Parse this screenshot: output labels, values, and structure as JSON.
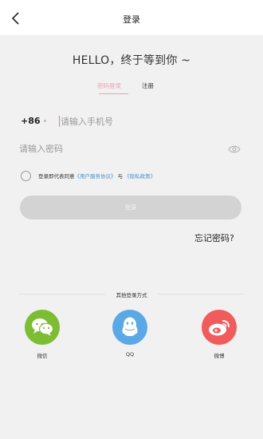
{
  "header": {
    "title": "登录"
  },
  "greeting": "HELLO，终于等到你 ~",
  "tabs": {
    "login": "密码登录",
    "register": "注册"
  },
  "form": {
    "country_code": "+86",
    "phone_placeholder": "请输入手机号",
    "password_placeholder": "请输入密码"
  },
  "agreement": {
    "prefix": "登录即代表同意",
    "user_agreement": "《用户服务协议》",
    "and": "与",
    "privacy": "《隐私政策》"
  },
  "login_button": "登录",
  "forgot_password": "忘记密码?",
  "other_methods": {
    "title": "其他登录方式",
    "options": [
      {
        "label": "微信",
        "icon": "wechat-icon",
        "color": "#7dbd33"
      },
      {
        "label": "QQ",
        "icon": "qq-icon",
        "color": "#5aa9e6"
      },
      {
        "label": "微博",
        "icon": "weibo-icon",
        "color": "#f05b5b"
      }
    ]
  },
  "colors": {
    "accent": "#e7a3b6",
    "link": "#4a90c8",
    "button_disabled": "#d3d3d3"
  }
}
